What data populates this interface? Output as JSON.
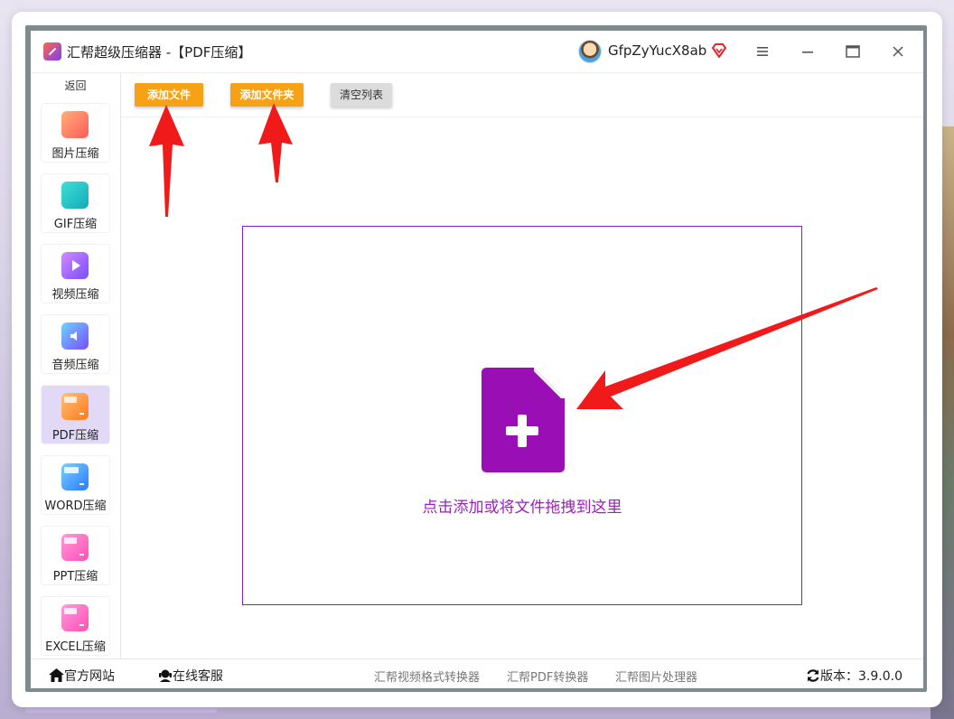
{
  "window": {
    "title": "汇帮超级压缩器  -【PDF压缩】",
    "user_name": "GfpZyYucX8ab"
  },
  "sidebar": {
    "back_label": "返回",
    "items": [
      {
        "label": "图片压缩",
        "icon": "image-icon",
        "color": "#ff7a5a"
      },
      {
        "label": "GIF压缩",
        "icon": "gif-icon",
        "color": "#1fc7c1"
      },
      {
        "label": "视频压缩",
        "icon": "video-icon",
        "color": "#a46bff"
      },
      {
        "label": "音频压缩",
        "icon": "audio-icon",
        "color": "#7a6bff"
      },
      {
        "label": "PDF压缩",
        "icon": "pdf-icon",
        "color": "#ff8a2a",
        "active": true
      },
      {
        "label": "WORD压缩",
        "icon": "word-icon",
        "color": "#3a8cff"
      },
      {
        "label": "PPT压缩",
        "icon": "ppt-icon",
        "color": "#ff5fc0"
      },
      {
        "label": "EXCEL压缩",
        "icon": "excel-icon",
        "color": "#ff5fc0"
      }
    ]
  },
  "toolbar": {
    "add_file": "添加文件",
    "add_folder": "添加文件夹",
    "clear_list": "清空列表"
  },
  "dropzone": {
    "hint": "点击添加或将文件拖拽到这里"
  },
  "footer": {
    "website": "官方网站",
    "support": "在线客服",
    "links": [
      "汇帮视频格式转换器",
      "汇帮PDF转换器",
      "汇帮图片处理器"
    ],
    "version": "版本：3.9.0.0"
  },
  "colors": {
    "accent_orange": "#f7a215",
    "accent_purple": "#9b1fbf",
    "annotation_red": "#f01a1a"
  }
}
